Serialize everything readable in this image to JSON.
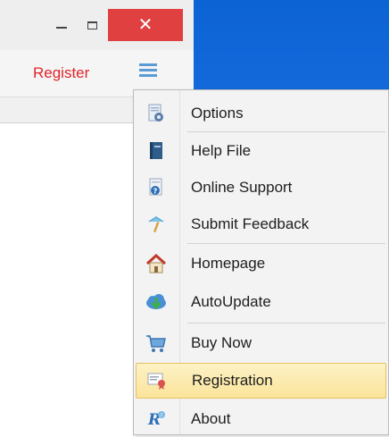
{
  "window": {
    "close_symbol": "✕",
    "register_label": "Register"
  },
  "menu": {
    "items": [
      {
        "label": "Options",
        "icon": "options-icon"
      },
      {
        "label": "Help File",
        "icon": "help-book-icon"
      },
      {
        "label": "Online Support",
        "icon": "online-support-icon"
      },
      {
        "label": "Submit Feedback",
        "icon": "feedback-icon"
      },
      {
        "label": "Homepage",
        "icon": "home-icon"
      },
      {
        "label": "AutoUpdate",
        "icon": "cloud-download-icon"
      },
      {
        "label": "Buy Now",
        "icon": "shopping-cart-icon"
      },
      {
        "label": "Registration",
        "icon": "certificate-icon"
      },
      {
        "label": "About",
        "icon": "about-icon"
      }
    ],
    "selected": "Registration"
  },
  "colors": {
    "accent_red": "#e0252a",
    "close_button": "#e0403f",
    "desktop_blue": "#1a6fe0",
    "highlight": "#fbe49a"
  }
}
